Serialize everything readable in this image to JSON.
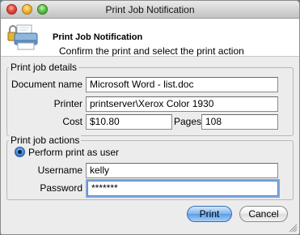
{
  "window": {
    "title": "Print Job Notification"
  },
  "header": {
    "title": "Print Job Notification",
    "subtitle": "Confirm the print and select the print action"
  },
  "details": {
    "legend": "Print job details",
    "document_label": "Document name",
    "document_value": "Microsoft Word - list.doc",
    "printer_label": "Printer",
    "printer_value": "printserver\\Xerox Color 1930",
    "cost_label": "Cost",
    "cost_value": "$10.80",
    "pages_label": "Pages",
    "pages_value": "108"
  },
  "actions": {
    "legend": "Print job actions",
    "option_label": "Perform print as user",
    "username_label": "Username",
    "username_value": "kelly",
    "password_label": "Password",
    "password_value": "*******"
  },
  "buttons": {
    "print": "Print",
    "cancel": "Cancel"
  },
  "colors": {
    "accent": "#5b9be6",
    "window_bg": "#ececec"
  }
}
